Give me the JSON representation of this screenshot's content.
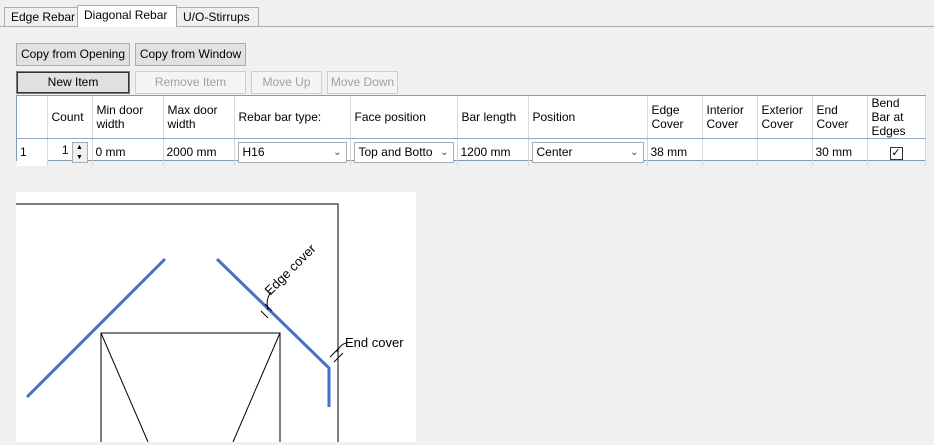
{
  "tabs": [
    "Edge Rebar",
    "Diagonal Rebar",
    "U/O-Stirrups"
  ],
  "buttons": {
    "copy_opening": "Copy from Opening",
    "copy_window": "Copy from Window",
    "new_item": "New Item",
    "remove_item": "Remove Item",
    "move_up": "Move Up",
    "move_down": "Move Down"
  },
  "grid": {
    "headers": [
      "Count",
      "Min door width",
      "Max door width",
      "Rebar bar type:",
      "Face position",
      "Bar length",
      "Position",
      "Edge Cover",
      "Interior Cover",
      "Exterior Cover",
      "End Cover",
      "Bend Bar at Edges"
    ],
    "row": {
      "index": "1",
      "count": "1",
      "min_width": "0 mm",
      "max_width": "2000 mm",
      "bar_type": "H16",
      "face_position": "Top and Botto",
      "bar_length": "1200 mm",
      "position": "Center",
      "edge_cover": "38 mm",
      "interior_cover": "",
      "exterior_cover": "",
      "end_cover": "30 mm",
      "bend_check": "✓"
    }
  },
  "diagram": {
    "edge_cover_label": "Edge cover",
    "end_cover_label": "End cover",
    "bar_color": "#4472c4"
  }
}
